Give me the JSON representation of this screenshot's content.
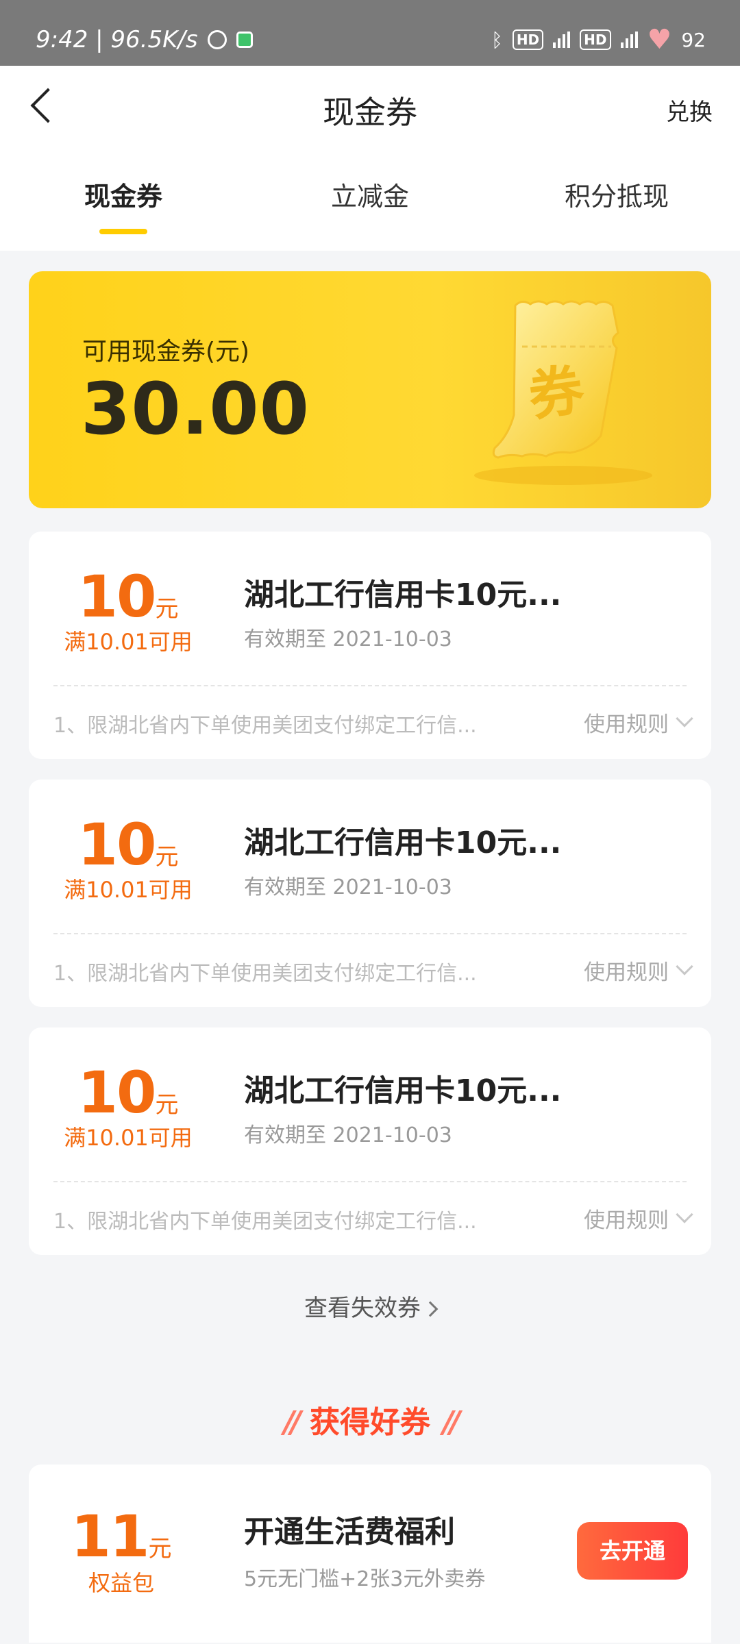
{
  "status_bar": {
    "time_speed": "9:42 | 96.5K/s",
    "hd1": "HD",
    "hd2": "HD",
    "battery": "92"
  },
  "header": {
    "title": "现金券",
    "exchange": "兑换",
    "tabs": [
      {
        "label": "现金券",
        "active": true
      },
      {
        "label": "立减金",
        "active": false
      },
      {
        "label": "积分抵现",
        "active": false
      }
    ]
  },
  "balance": {
    "label": "可用现金券(元)",
    "value": "30.00",
    "ticket_char": "券"
  },
  "coupons": [
    {
      "amount": "10",
      "unit": "元",
      "condition": "满10.01可用",
      "title": "湖北工行信用卡10元...",
      "expiry": "有效期至 2021-10-03",
      "desc": "1、限湖北省内下单使用美团支付绑定工行信...",
      "rules": "使用规则"
    },
    {
      "amount": "10",
      "unit": "元",
      "condition": "满10.01可用",
      "title": "湖北工行信用卡10元...",
      "expiry": "有效期至 2021-10-03",
      "desc": "1、限湖北省内下单使用美团支付绑定工行信...",
      "rules": "使用规则"
    },
    {
      "amount": "10",
      "unit": "元",
      "condition": "满10.01可用",
      "title": "湖北工行信用卡10元...",
      "expiry": "有效期至 2021-10-03",
      "desc": "1、限湖北省内下单使用美团支付绑定工行信...",
      "rules": "使用规则"
    }
  ],
  "expired_link": "查看失效券",
  "promo": {
    "heading": "获得好券",
    "amount": "11",
    "unit": "元",
    "sub": "权益包",
    "title": "开通生活费福利",
    "desc": "5元无门槛+2张3元外卖券",
    "button": "去开通"
  },
  "colors": {
    "accent_yellow": "#ffcc00",
    "coupon_orange": "#f36b10",
    "promo_red": "#ff4b2b"
  }
}
